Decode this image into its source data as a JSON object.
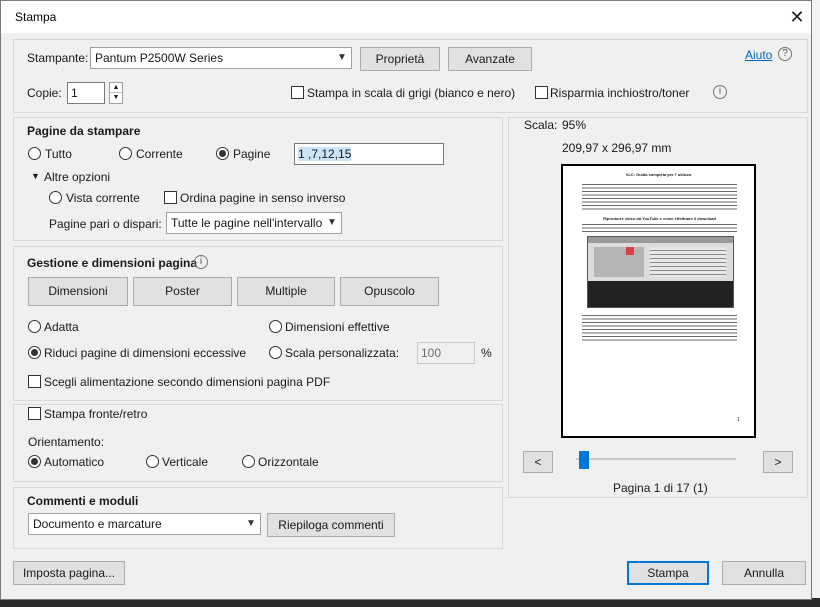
{
  "window": {
    "title": "Stampa",
    "close_glyph": "✕"
  },
  "printer": {
    "label": "Stampante:",
    "selected": "Pantum P2500W Series",
    "properties_button": "Proprietà",
    "advanced_button": "Avanzate",
    "help_link": "Aiuto"
  },
  "copies": {
    "label": "Copie:",
    "value": "1",
    "grayscale_label": "Stampa in scala di grigi (bianco e nero)",
    "grayscale_checked": false,
    "save_ink_label": "Risparmia inchiostro/toner",
    "save_ink_checked": false
  },
  "pages": {
    "heading": "Pagine da stampare",
    "all_label": "Tutto",
    "current_label": "Corrente",
    "pages_label": "Pagine",
    "pages_value": "1 ,7,12,15",
    "selected": "pages",
    "more_options_label": "Altre opzioni",
    "current_view_label": "Vista corrente",
    "reverse_order_label": "Ordina pagine in senso inverso",
    "odd_even_label": "Pagine pari o dispari:",
    "odd_even_value": "Tutte le pagine nell'intervallo"
  },
  "sizing": {
    "heading": "Gestione e dimensioni pagina",
    "tabs": [
      "Dimensioni",
      "Poster",
      "Multiple",
      "Opuscolo"
    ],
    "fit_label": "Adatta",
    "actual_size_label": "Dimensioni effettive",
    "shrink_label": "Riduci pagine di dimensioni eccessive",
    "custom_scale_label": "Scala personalizzata:",
    "custom_scale_value": "100",
    "percent": "%",
    "selected": "shrink",
    "paper_source_label": "Scegli alimentazione secondo dimensioni pagina PDF"
  },
  "duplex": {
    "label": "Stampa fronte/retro",
    "checked": false
  },
  "orientation": {
    "label": "Orientamento:",
    "options": [
      "Automatico",
      "Verticale",
      "Orizzontale"
    ],
    "selected": "Automatico"
  },
  "comments": {
    "heading": "Commenti e moduli",
    "selected": "Documento e marcature",
    "summarize_button": "Riepiloga commenti"
  },
  "preview": {
    "scale_label": "Scala:",
    "scale_value": "95%",
    "dimensions": "209,97 x 296,97 mm",
    "doc_title": "VLC: Guida completa per l' utilizzo",
    "doc_subtitle": "Riprodurre video da YouTube e come effettuare il download",
    "page_number": "1",
    "page_info": "Pagina 1 di 17 (1)",
    "prev_glyph": "<",
    "next_glyph": ">",
    "slider_position": 0
  },
  "footer": {
    "page_setup_button": "Imposta pagina...",
    "print_button": "Stampa",
    "cancel_button": "Annulla"
  },
  "colors": {
    "accent": "#0078d7",
    "dialog_bg": "#f0f0f0",
    "link": "#0066cc"
  }
}
